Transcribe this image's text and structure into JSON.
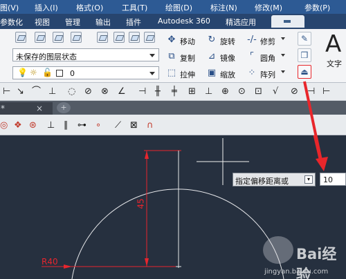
{
  "menu": {
    "items": [
      "图(V)",
      "插入(I)",
      "格式(O)",
      "工具(T)",
      "绘图(D)",
      "标注(N)",
      "修改(M)",
      "参数(P)"
    ]
  },
  "ribbon_tabs": {
    "items": [
      "参数化",
      "视图",
      "管理",
      "输出",
      "插件",
      "Autodesk 360",
      "精选应用"
    ]
  },
  "layer_panel": {
    "layer_state": "未保存的图层状态",
    "current_layer": "0"
  },
  "modify_panel": {
    "move": "移动",
    "rotate": "旋转",
    "trim": "修剪",
    "copy": "复制",
    "mirror": "镜像",
    "fillet": "圆角",
    "stretch": "拉伸",
    "scale": "缩放",
    "array": "阵列"
  },
  "annotation_panel": {
    "text_icon": "A",
    "text_label": "文字"
  },
  "document": {
    "tab_marker": "*",
    "close": "×",
    "new_tab": "+"
  },
  "prompt": {
    "text": "指定偏移距离或",
    "input_value": "10"
  },
  "drawing": {
    "dim_vertical": "45",
    "dim_radius": "R40"
  },
  "watermark": {
    "brand": "Bai经验",
    "url": "jingyan.baidu.com"
  },
  "colors": {
    "menubar": "#2d5a94",
    "canvas": "#26303f",
    "dimension": "#e8252d",
    "arrow": "#e8262b"
  }
}
